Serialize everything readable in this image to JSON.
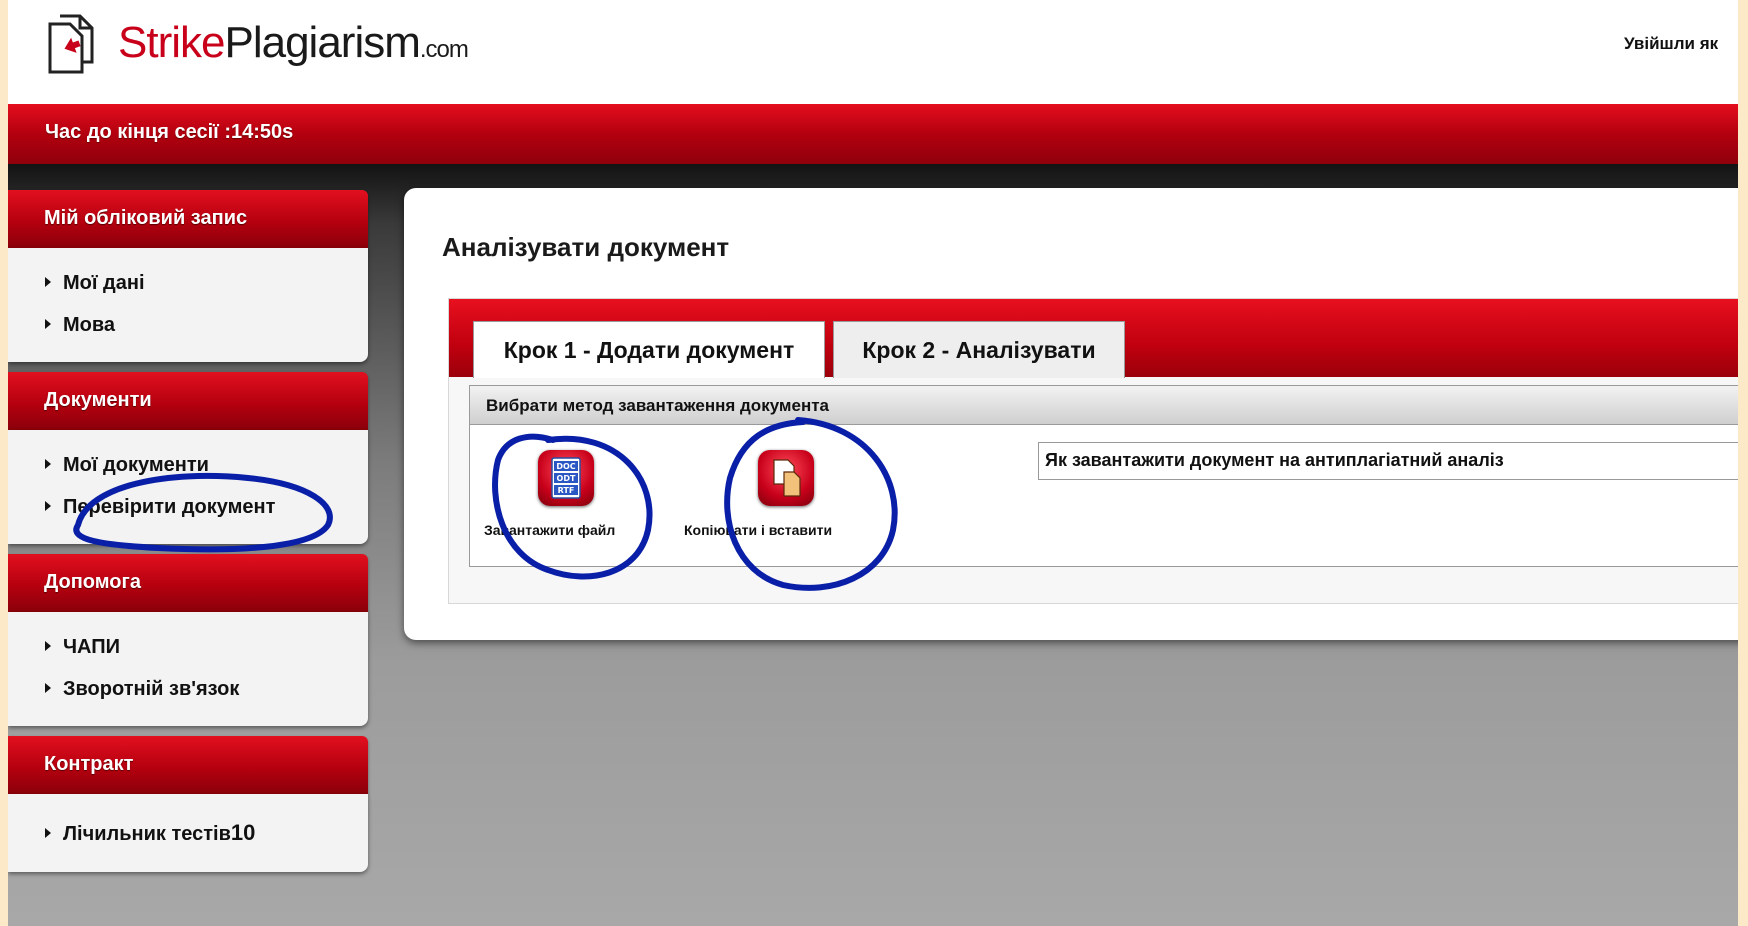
{
  "header": {
    "logo": {
      "strike": "Strike",
      "plagiarism": "Plagiarism",
      "com": ".com"
    },
    "user_status": "Увійшли як"
  },
  "session": {
    "timer_text": "Час до кінця сесії :14:50s"
  },
  "sidebar": {
    "sections": [
      {
        "title": "Мій обліковий запис",
        "items": [
          {
            "label": "Мої дані"
          },
          {
            "label": "Мова"
          }
        ]
      },
      {
        "title": "Документи",
        "items": [
          {
            "label": "Мої документи"
          },
          {
            "label": "Перевірити документ"
          }
        ]
      },
      {
        "title": "Допомога",
        "items": [
          {
            "label": "ЧАПИ"
          },
          {
            "label": "Зворотній зв'язок"
          }
        ]
      },
      {
        "title": "Контракт",
        "items": [
          {
            "label": "Лічильник тестів",
            "count": "10"
          }
        ]
      }
    ]
  },
  "main": {
    "title": "Аналізувати документ",
    "tabs": [
      {
        "label": "Крок 1 - Додати документ"
      },
      {
        "label": "Крок 2 - Аналізувати"
      }
    ],
    "method_header": "Вибрати метод завантаження документа",
    "methods": [
      {
        "label": "Завантажити файл",
        "icon_lines": [
          "DOC",
          "ODT",
          "RTF"
        ]
      },
      {
        "label": "Копіювати і вставити"
      }
    ],
    "help_text": "Як завантажити документ на антиплагіатний аналіз"
  },
  "colors": {
    "brand_red": "#c8001a",
    "annotation_blue": "#0a1fa8"
  }
}
